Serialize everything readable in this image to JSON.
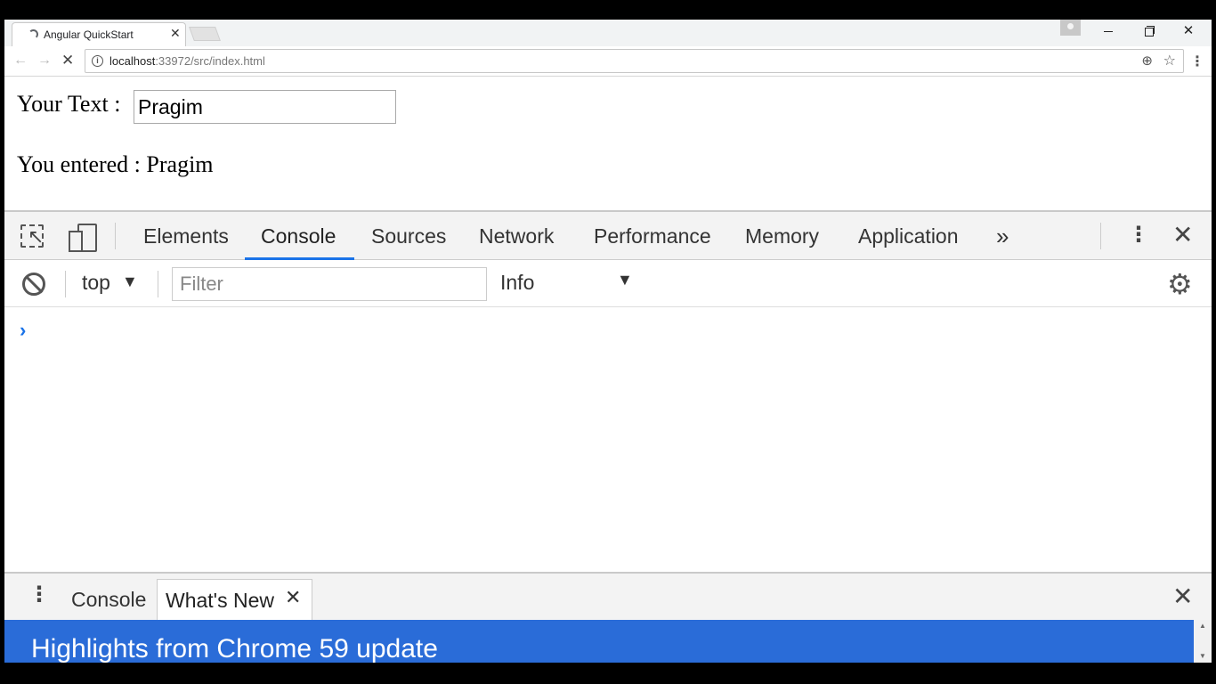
{
  "browser": {
    "tab_title": "Angular QuickStart",
    "tab_close": "✕",
    "url_host": "localhost",
    "url_rest": ":33972/src/index.html",
    "icons": {
      "back": "back-arrow-icon",
      "forward": "forward-arrow-icon",
      "stop": "stop-icon",
      "info": "info-icon",
      "zoom": "zoom-icon",
      "star": "star-icon",
      "menu": "kebab-menu-icon"
    },
    "window_close": "✕"
  },
  "page": {
    "label": "Your Text :",
    "input_value": "Pragim",
    "entered_prefix": "You entered :",
    "entered_value": "Pragim"
  },
  "devtools": {
    "tabs": [
      "Elements",
      "Console",
      "Sources",
      "Network",
      "Performance",
      "Memory",
      "Application"
    ],
    "active_tab": "Console",
    "more_tabs": "»",
    "close": "✕",
    "context": "top",
    "filter_placeholder": "Filter",
    "level": "Info",
    "prompt": "›",
    "accent_color": "#1a73e8"
  },
  "drawer": {
    "tabs": [
      "Console",
      "What's New"
    ],
    "close": "✕",
    "whatsnew_close": "✕",
    "heading": "Highlights from Chrome 59 update",
    "banner_color": "#2a6cd8"
  }
}
